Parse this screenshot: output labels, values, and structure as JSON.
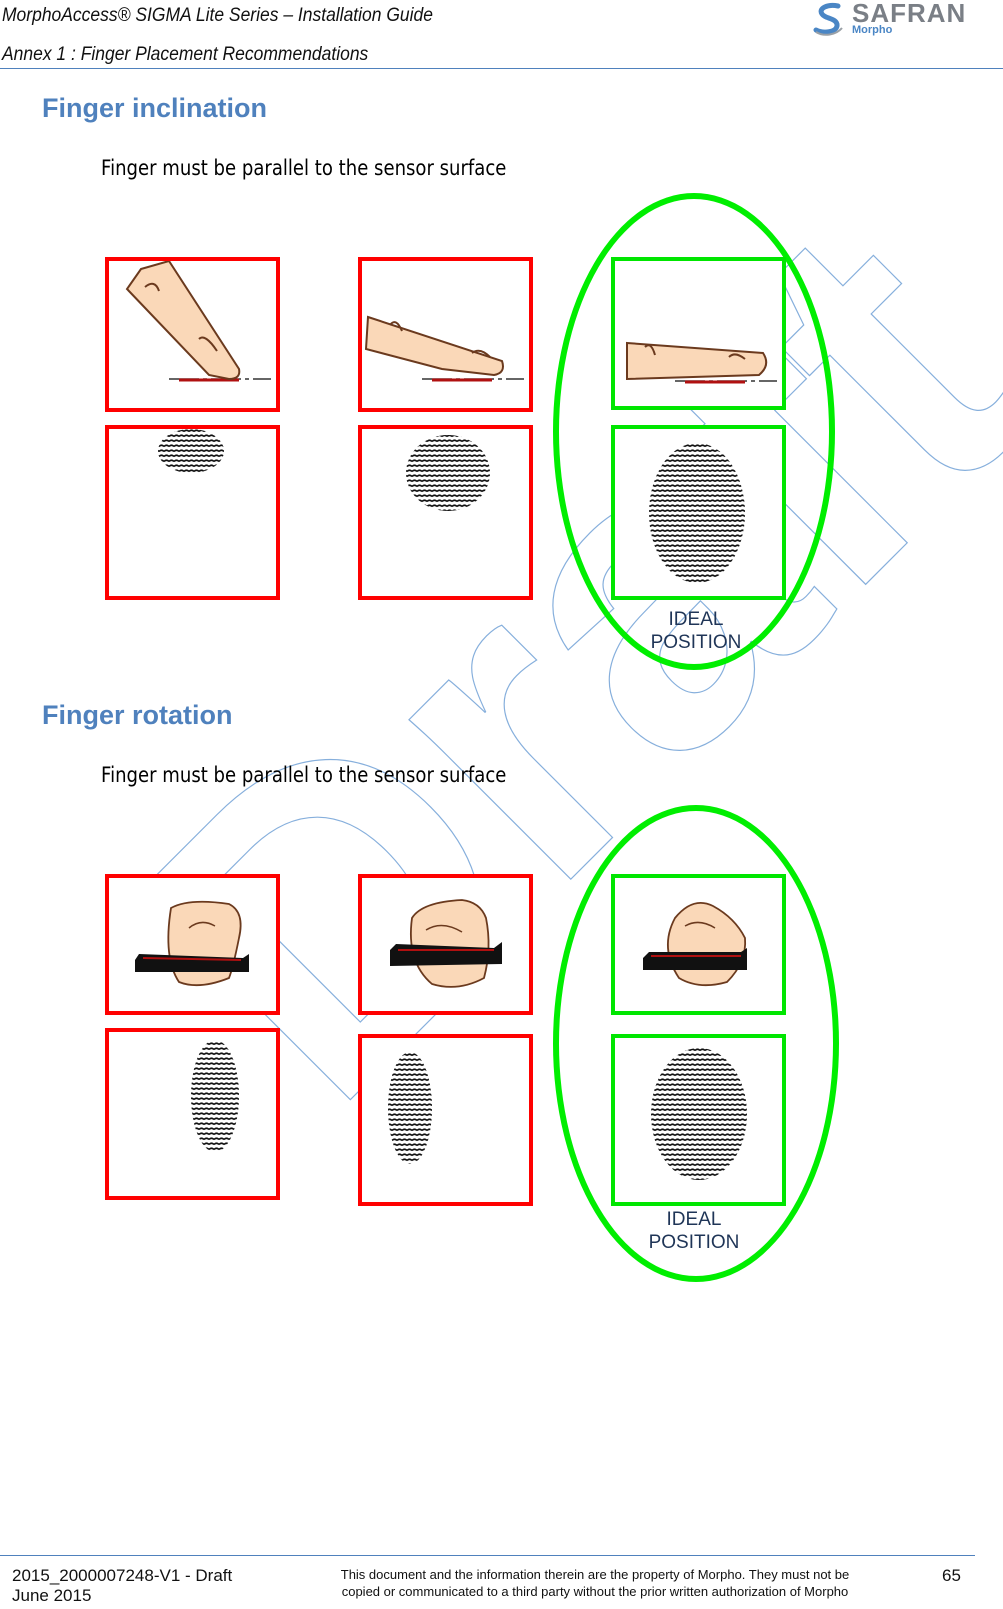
{
  "header": {
    "title": "MorphoAccess® SIGMA Lite Series – Installation Guide",
    "subtitle": "Annex 1 :  Finger Placement Recommendations",
    "logo": {
      "brand": "SAFRAN",
      "sub_brand": "Morpho",
      "icon": "safran-swoosh-icon"
    }
  },
  "watermark": {
    "text": "Draft",
    "color": "#4a86c5"
  },
  "sections": [
    {
      "heading": "Finger inclination",
      "instruction": "Finger must be parallel to the sensor surface",
      "examples": [
        {
          "status": "incorrect",
          "finger_view": "finger steeply inclined on sensor",
          "print_view": "small partial fingerprint (tip only)"
        },
        {
          "status": "incorrect",
          "finger_view": "finger slightly inclined on sensor",
          "print_view": "medium partial fingerprint"
        },
        {
          "status": "correct",
          "finger_view": "finger flat on sensor",
          "print_view": "full fingerprint",
          "label": "IDEAL\nPOSITION"
        }
      ]
    },
    {
      "heading": "Finger rotation",
      "instruction": "Finger must be parallel to the sensor surface",
      "examples": [
        {
          "status": "incorrect",
          "finger_view": "finger rotated right on sensor",
          "print_view": "narrow fingerprint"
        },
        {
          "status": "incorrect",
          "finger_view": "finger rotated left on sensor",
          "print_view": "narrow fingerprint"
        },
        {
          "status": "correct",
          "finger_view": "finger centered on sensor",
          "print_view": "full fingerprint",
          "label": "IDEAL\nPOSITION"
        }
      ]
    }
  ],
  "ideal_label_line1": "IDEAL",
  "ideal_label_line2": "POSITION",
  "colors": {
    "incorrect": "#ff0000",
    "correct": "#00e600",
    "heading": "#4f81bd"
  },
  "footer": {
    "doc_id": "2015_2000007248-V1 - Draft",
    "date": "June 2015",
    "notice_line1": "This document and the information therein are the property of Morpho. They must not be",
    "notice_line2": "copied or communicated to a third party without the prior written authorization of Morpho",
    "page_number": "65"
  }
}
